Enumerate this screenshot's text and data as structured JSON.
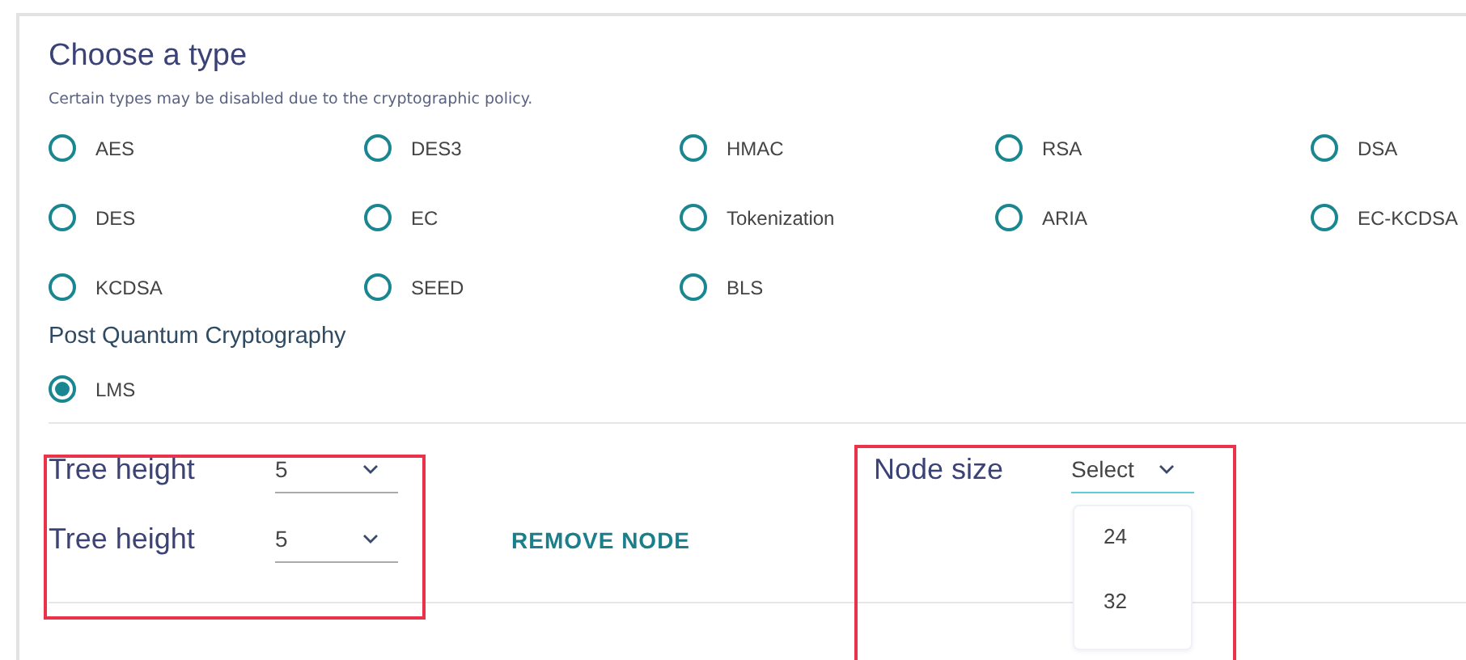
{
  "title": "Choose a type",
  "note": "Certain types may be disabled due to the cryptographic policy.",
  "types": [
    {
      "label": "AES",
      "selected": false
    },
    {
      "label": "DES3",
      "selected": false
    },
    {
      "label": "HMAC",
      "selected": false
    },
    {
      "label": "RSA",
      "selected": false
    },
    {
      "label": "DSA",
      "selected": false
    },
    {
      "label": "DES",
      "selected": false
    },
    {
      "label": "EC",
      "selected": false
    },
    {
      "label": "Tokenization",
      "selected": false
    },
    {
      "label": "ARIA",
      "selected": false
    },
    {
      "label": "EC-KCDSA",
      "selected": false
    },
    {
      "label": "KCDSA",
      "selected": false
    },
    {
      "label": "SEED",
      "selected": false
    },
    {
      "label": "BLS",
      "selected": false
    }
  ],
  "pqc": {
    "heading": "Post Quantum Cryptography",
    "types": [
      {
        "label": "LMS",
        "selected": true
      }
    ]
  },
  "tree_heights": [
    {
      "label": "Tree height",
      "value": "5"
    },
    {
      "label": "Tree height",
      "value": "5"
    }
  ],
  "remove_button": "REMOVE NODE",
  "node_size": {
    "label": "Node size",
    "value": "Select",
    "expanded": true,
    "options": [
      "24",
      "32"
    ]
  }
}
